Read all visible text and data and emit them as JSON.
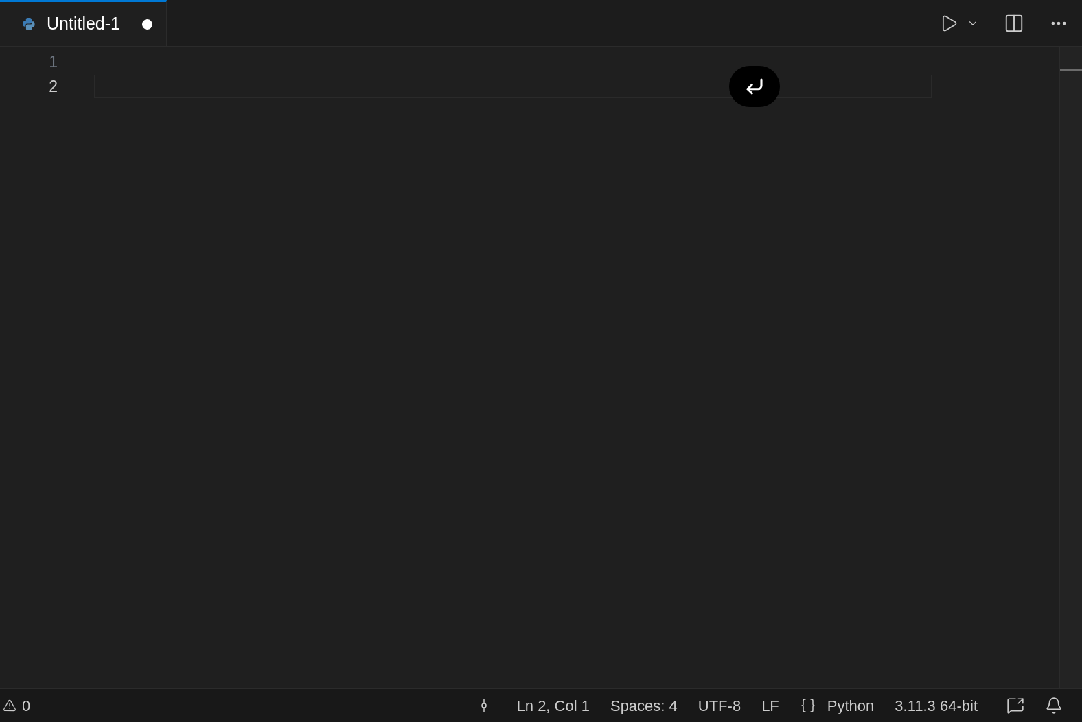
{
  "tabs": [
    {
      "label": "Untitled-1",
      "selected": true,
      "modified": true
    }
  ],
  "editor": {
    "lines": [
      {
        "number": "1",
        "current": false
      },
      {
        "number": "2",
        "current": true
      }
    ]
  },
  "status_bar": {
    "problems": "0",
    "position": "Ln 2, Col 1",
    "indentation": "Spaces: 4",
    "encoding": "UTF-8",
    "line_ending": "LF",
    "language": "Python",
    "interpreter": "3.11.3 64-bit"
  }
}
